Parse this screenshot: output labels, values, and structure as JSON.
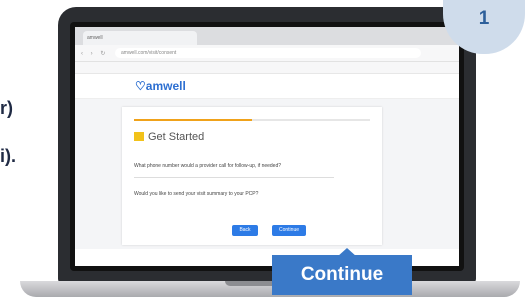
{
  "left_text": {
    "line1": "r)",
    "line2": "i)."
  },
  "step_badge": {
    "number": "1"
  },
  "browser": {
    "tab_label": "amwell",
    "url": "amwell.com/visit/consent"
  },
  "site": {
    "logo": "amwell",
    "card": {
      "title": "Get Started",
      "question1": "What phone number would a provider call for follow-up, if needed?",
      "question2": "Would you like to send your visit summary to your PCP?"
    },
    "buttons": {
      "back": "Back",
      "continue_small": "Continue"
    }
  },
  "callout": {
    "label": "Continue"
  },
  "colors": {
    "accent": "#3a79c8",
    "badge_bg": "#cfdceb",
    "badge_text": "#2d5f9a"
  }
}
